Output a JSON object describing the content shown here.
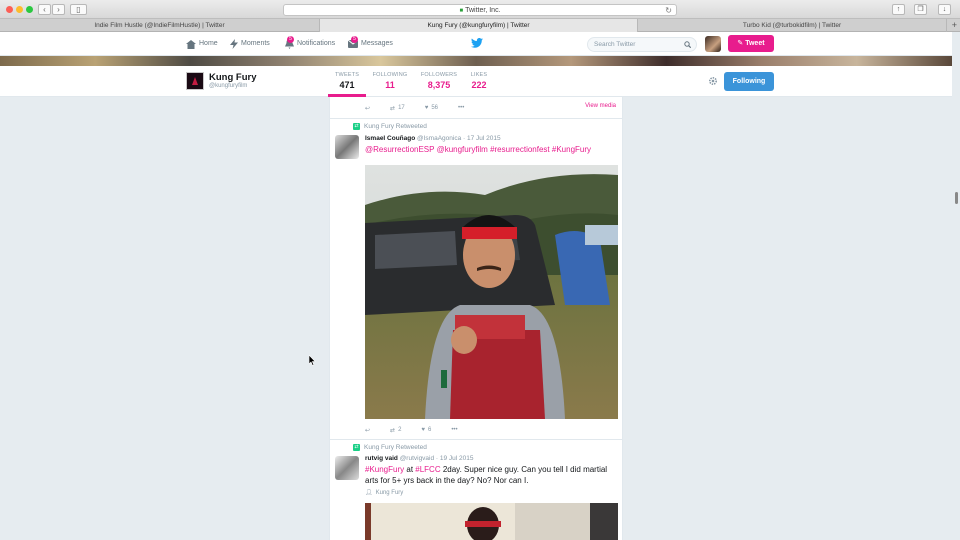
{
  "browser": {
    "url": "Twitter, Inc.",
    "tabs": [
      {
        "label": "Indie Film Hustle (@IndieFilmHustle) | Twitter",
        "active": false
      },
      {
        "label": "Kung Fury (@kungfuryfilm) | Twitter",
        "active": true
      },
      {
        "label": "Turbo Kid (@turbokidfilm) | Twitter",
        "active": false
      }
    ],
    "new_tab": "+"
  },
  "nav": {
    "home": "Home",
    "moments": "Moments",
    "notifications": "Notifications",
    "notifications_badge": "5",
    "messages": "Messages",
    "messages_badge": "5",
    "search_placeholder": "Search Twitter",
    "tweet_button": "Tweet"
  },
  "profile": {
    "name": "Kung Fury",
    "handle": "@kungfuryfilm",
    "stats": [
      {
        "label": "TWEETS",
        "value": "471"
      },
      {
        "label": "FOLLOWING",
        "value": "11"
      },
      {
        "label": "FOLLOWERS",
        "value": "8,375"
      },
      {
        "label": "LIKES",
        "value": "222"
      }
    ],
    "following_button": "Following"
  },
  "timeline": {
    "top_actions": {
      "retweets": "17",
      "likes": "56",
      "view_media": "View media"
    },
    "tweets": [
      {
        "retweet_label": "Kung Fury Retweeted",
        "name": "Ismael Couñago",
        "handle": "@IsmaAgonica",
        "date": "· 17 Jul 2015",
        "text_parts": [
          "@ResurrectionESP",
          " ",
          "@kungfuryfilm",
          " ",
          "#resurrectionfest",
          " ",
          "#KungFury"
        ],
        "retweets": "2",
        "likes": "6"
      },
      {
        "retweet_label": "Kung Fury Retweeted",
        "name": "rutvig vaid",
        "handle": "@rutvigvaid",
        "date": "· 19 Jul 2015",
        "text_line1_a": "#KungFury",
        "text_line1_b": " at ",
        "text_line1_c": "#LFCC",
        "text_line1_d": " 2day. Super nice guy. Can you tell I did martial",
        "text_line2": "arts for 5+ yrs back in the day? No? Nor can I.",
        "tagged": "Kung Fury"
      }
    ]
  },
  "colors": {
    "accent": "#e81c8d",
    "follow_blue": "#3b94d9",
    "retweet_green": "#19cf86"
  }
}
